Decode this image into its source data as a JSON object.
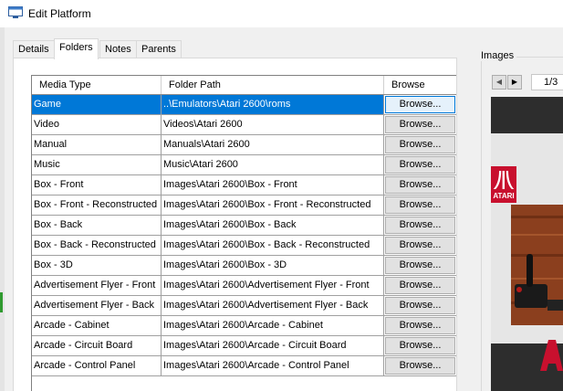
{
  "window": {
    "title": "Edit Platform"
  },
  "tabs": [
    {
      "label": "Details"
    },
    {
      "label": "Folders"
    },
    {
      "label": "Notes"
    },
    {
      "label": "Parents"
    }
  ],
  "active_tab": "Folders",
  "grid": {
    "columns": [
      "Media Type",
      "Folder Path",
      "Browse"
    ],
    "rows": [
      {
        "media_type": "Game",
        "folder_path": "..\\Emulators\\Atari 2600\\roms",
        "browse": "Browse...",
        "selected": true
      },
      {
        "media_type": "Video",
        "folder_path": "Videos\\Atari 2600",
        "browse": "Browse..."
      },
      {
        "media_type": "Manual",
        "folder_path": "Manuals\\Atari 2600",
        "browse": "Browse..."
      },
      {
        "media_type": "Music",
        "folder_path": "Music\\Atari 2600",
        "browse": "Browse..."
      },
      {
        "media_type": "Box - Front",
        "folder_path": "Images\\Atari 2600\\Box - Front",
        "browse": "Browse..."
      },
      {
        "media_type": "Box - Front - Reconstructed",
        "folder_path": "Images\\Atari 2600\\Box - Front - Reconstructed",
        "browse": "Browse..."
      },
      {
        "media_type": "Box - Back",
        "folder_path": "Images\\Atari 2600\\Box - Back",
        "browse": "Browse..."
      },
      {
        "media_type": "Box - Back - Reconstructed",
        "folder_path": "Images\\Atari 2600\\Box - Back - Reconstructed",
        "browse": "Browse..."
      },
      {
        "media_type": "Box - 3D",
        "folder_path": "Images\\Atari 2600\\Box - 3D",
        "browse": "Browse..."
      },
      {
        "media_type": "Advertisement Flyer - Front",
        "folder_path": "Images\\Atari 2600\\Advertisement Flyer - Front",
        "browse": "Browse..."
      },
      {
        "media_type": "Advertisement Flyer - Back",
        "folder_path": "Images\\Atari 2600\\Advertisement Flyer - Back",
        "browse": "Browse..."
      },
      {
        "media_type": "Arcade - Cabinet",
        "folder_path": "Images\\Atari 2600\\Arcade - Cabinet",
        "browse": "Browse..."
      },
      {
        "media_type": "Arcade - Circuit Board",
        "folder_path": "Images\\Atari 2600\\Arcade - Circuit Board",
        "browse": "Browse..."
      },
      {
        "media_type": "Arcade - Control Panel",
        "folder_path": "Images\\Atari 2600\\Arcade - Control Panel",
        "browse": "Browse..."
      }
    ]
  },
  "images_panel": {
    "label": "Images",
    "page_counter": "1/3",
    "logo_text": "ATARI"
  },
  "colors": {
    "selection": "#0078d7",
    "atari_red": "#c8102e",
    "woodgrain": "#8b3f1e"
  },
  "icons": {
    "window": "window-icon",
    "prev": "triangle-left-icon",
    "next": "triangle-right-icon"
  }
}
